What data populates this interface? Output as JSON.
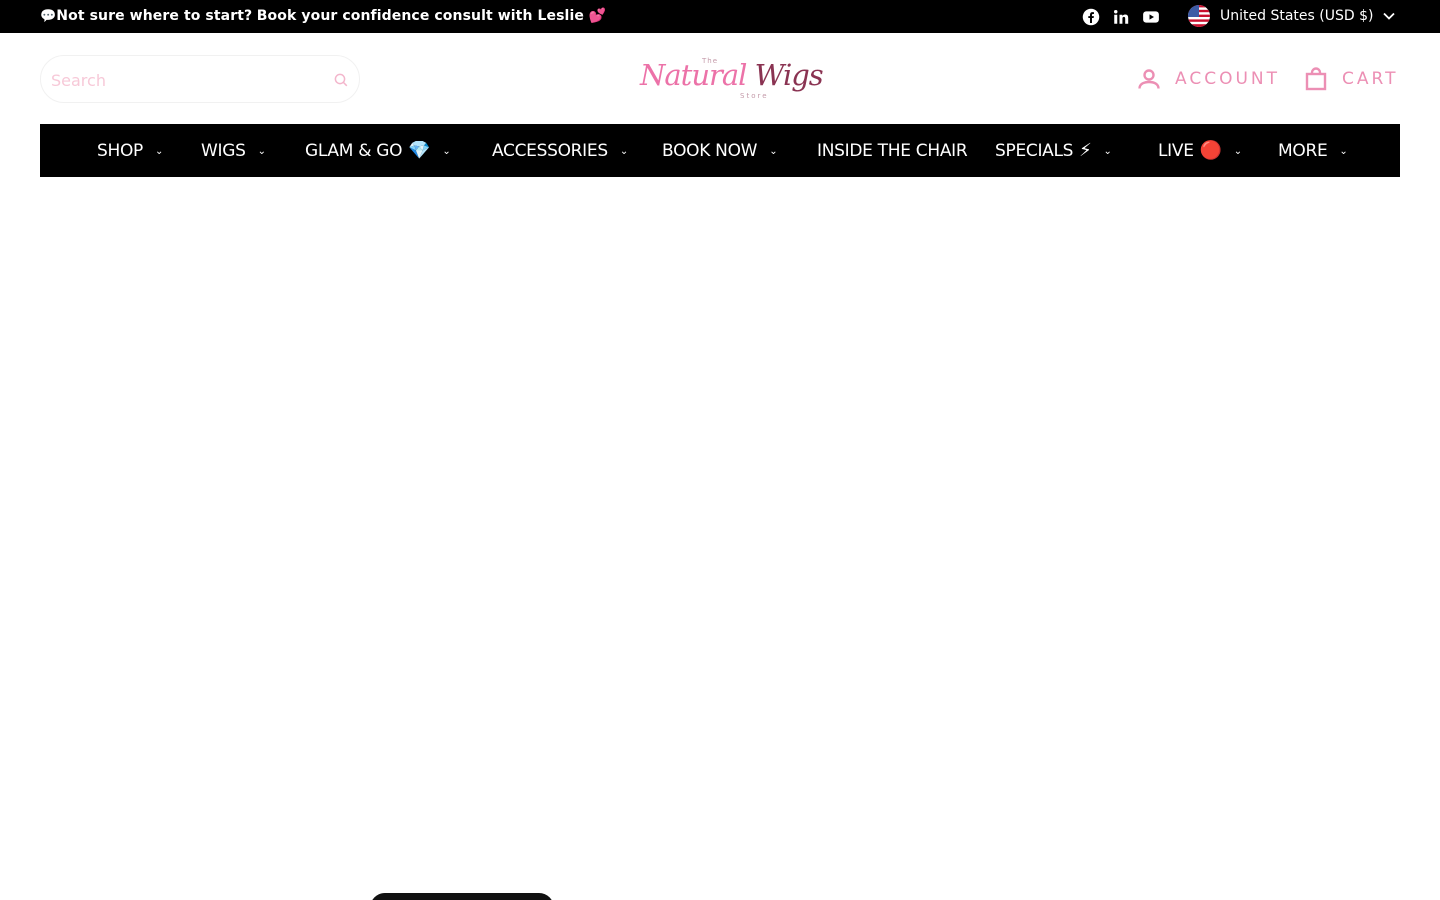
{
  "announcement": {
    "speech_emoji": "💬",
    "bold_text": "Not sure where to start?",
    "rest_text": "Book your confidence consult with Leslie",
    "heart_emoji": "💕"
  },
  "social": {
    "facebook_icon": "facebook-icon",
    "linkedin_icon": "linkedin-icon",
    "youtube_icon": "youtube-icon"
  },
  "currency": {
    "label": "United States (USD $)",
    "flag_icon": "us-flag-icon"
  },
  "search": {
    "placeholder": "Search",
    "value": ""
  },
  "logo": {
    "the": "The",
    "word1": "Natural",
    "word2": "Wigs",
    "store": "Store"
  },
  "header": {
    "account_label": "ACCOUNT",
    "cart_label": "CART"
  },
  "nav": {
    "items": [
      {
        "label": "SHOP",
        "emoji": "",
        "has_dropdown": true
      },
      {
        "label": "WIGS",
        "emoji": "",
        "has_dropdown": true
      },
      {
        "label": "GLAM & GO",
        "emoji": "💎",
        "has_dropdown": true
      },
      {
        "label": "ACCESSORIES",
        "emoji": "",
        "has_dropdown": true
      },
      {
        "label": "BOOK NOW",
        "emoji": "",
        "has_dropdown": true
      },
      {
        "label": "INSIDE THE CHAIR",
        "emoji": "",
        "has_dropdown": false
      },
      {
        "label": "SPECIALS",
        "emoji": "⚡",
        "has_dropdown": true
      },
      {
        "label": "LIVE",
        "emoji": "🔴",
        "has_dropdown": true
      },
      {
        "label": "MORE",
        "emoji": "",
        "has_dropdown": true
      }
    ]
  },
  "colors": {
    "brand_pink": "#ec72a8",
    "brand_burgundy": "#8a3352",
    "header_link": "#ec8fb4",
    "bar_bg": "#000000"
  }
}
